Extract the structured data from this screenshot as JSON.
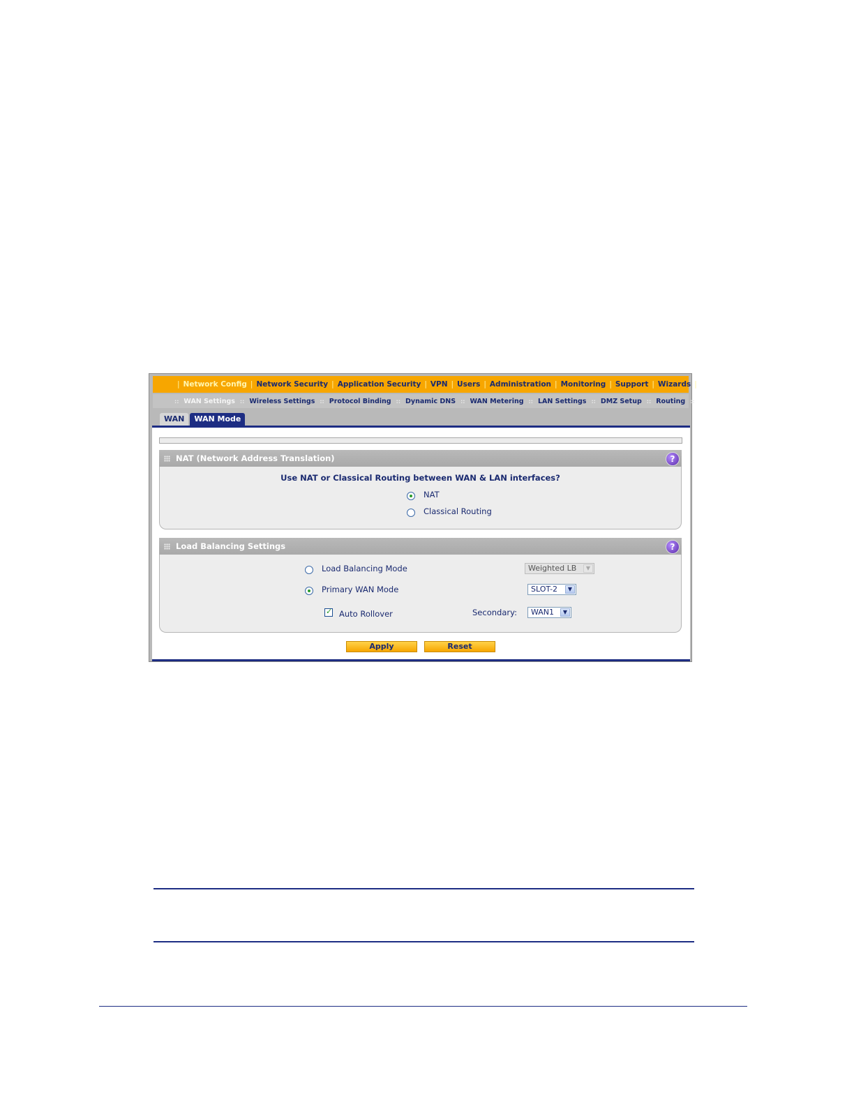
{
  "top_nav": {
    "items": [
      {
        "label": "Network Config",
        "active": true
      },
      {
        "label": "Network Security",
        "active": false
      },
      {
        "label": "Application Security",
        "active": false
      },
      {
        "label": "VPN",
        "active": false
      },
      {
        "label": "Users",
        "active": false
      },
      {
        "label": "Administration",
        "active": false
      },
      {
        "label": "Monitoring",
        "active": false
      },
      {
        "label": "Support",
        "active": false
      },
      {
        "label": "Wizards",
        "active": false
      }
    ]
  },
  "sub_nav": {
    "items": [
      {
        "label": "WAN Settings",
        "active": true
      },
      {
        "label": "Wireless Settings",
        "active": false
      },
      {
        "label": "Protocol Binding",
        "active": false
      },
      {
        "label": "Dynamic DNS",
        "active": false
      },
      {
        "label": "WAN Metering",
        "active": false
      },
      {
        "label": "LAN Settings",
        "active": false
      },
      {
        "label": "DMZ Setup",
        "active": false
      },
      {
        "label": "Routing",
        "active": false
      }
    ]
  },
  "tabs": [
    {
      "label": "WAN",
      "active": false
    },
    {
      "label": "WAN Mode",
      "active": true
    }
  ],
  "nat_section": {
    "title": "NAT (Network Address Translation)",
    "question": "Use NAT or Classical Routing between WAN & LAN interfaces?",
    "options": [
      {
        "label": "NAT",
        "checked": true
      },
      {
        "label": "Classical Routing",
        "checked": false
      }
    ]
  },
  "load_balancing": {
    "title": "Load Balancing Settings",
    "load_balancing_mode": {
      "label": "Load Balancing Mode",
      "checked": false,
      "select_value": "Weighted LB",
      "disabled": true
    },
    "primary_wan_mode": {
      "label": "Primary WAN Mode",
      "checked": true,
      "select_value": "SLOT-2"
    },
    "auto_rollover": {
      "label": "Auto Rollover",
      "checked": true
    },
    "secondary": {
      "label": "Secondary:",
      "select_value": "WAN1"
    }
  },
  "buttons": {
    "apply": "Apply",
    "reset": "Reset"
  },
  "icons": {
    "help": "help-icon",
    "grip": "grip-icon",
    "dropdown": "chevron-down-icon"
  },
  "colors": {
    "nav_orange": "#f7a600",
    "nav_text": "#1a2a70",
    "tab_active": "#1d2d83",
    "section_header": "#afafaf"
  }
}
